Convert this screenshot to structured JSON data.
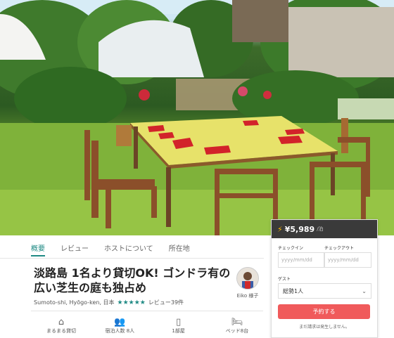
{
  "tabs": [
    {
      "label": "概要"
    },
    {
      "label": "レビュー"
    },
    {
      "label": "ホストについて"
    },
    {
      "label": "所在地"
    }
  ],
  "listing": {
    "title_line1": "淡路島 1名より貸切OK! ゴンドラ有の",
    "title_line2": "広い芝生の庭も独占め",
    "location": "Sumoto-shi, Hyōgo-ken, 日本",
    "stars": "★★★★★",
    "reviews": "レビュー39件"
  },
  "host": {
    "name": "Eiko 様子"
  },
  "amenities": [
    {
      "icon": "home-icon",
      "glyph": "⌂",
      "label": "まるまる貸切"
    },
    {
      "icon": "guests-icon",
      "glyph": "👥",
      "label": "宿泊人数 8人"
    },
    {
      "icon": "door-icon",
      "glyph": "▯",
      "label": "1部屋"
    },
    {
      "icon": "bed-icon",
      "glyph": "🛏",
      "label": "ベッド8台"
    }
  ],
  "booking": {
    "price": "¥5,989",
    "unit": "/泊",
    "checkin_label": "チェックイン",
    "checkout_label": "チェックアウト",
    "checkin_placeholder": "yyyy/mm/dd",
    "checkout_placeholder": "yyyy/mm/dd",
    "guests_label": "ゲスト",
    "guests_value": "総勢1人",
    "reserve_label": "予約する",
    "note": "まだ請求は発生しません。"
  },
  "colors": {
    "accent": "#1f8a84",
    "reserve": "#f05a5b",
    "price_bar": "#3a3a3a"
  }
}
